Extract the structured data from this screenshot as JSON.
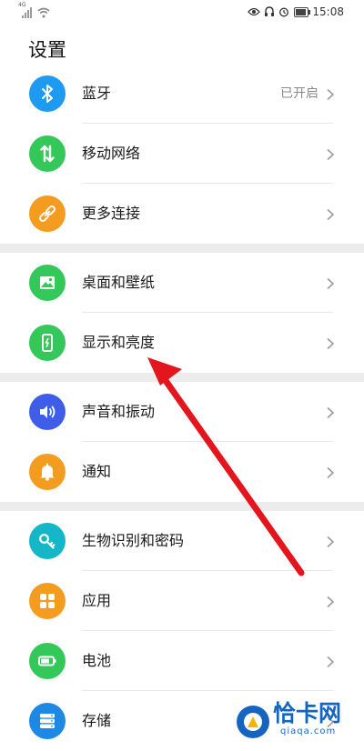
{
  "status_bar": {
    "network_label": "4G",
    "time": "15:08",
    "battery_level": 0.9,
    "icons": [
      "signal-icon",
      "wifi-icon",
      "eye-icon",
      "headset-icon",
      "alarm-icon",
      "battery-icon"
    ]
  },
  "page": {
    "title": "设置"
  },
  "groups": [
    [
      {
        "label": "蓝牙",
        "value": "已开启",
        "icon": "bluetooth-icon",
        "color": "#1e9bf0"
      },
      {
        "label": "移动网络",
        "value": "",
        "icon": "mobile-data-icon",
        "color": "#34c759"
      },
      {
        "label": "更多连接",
        "value": "",
        "icon": "link-icon",
        "color": "#f39c1f"
      }
    ],
    [
      {
        "label": "桌面和壁纸",
        "value": "",
        "icon": "wallpaper-icon",
        "color": "#34c759"
      },
      {
        "label": "显示和亮度",
        "value": "",
        "icon": "display-icon",
        "color": "#34c759"
      }
    ],
    [
      {
        "label": "声音和振动",
        "value": "",
        "icon": "speaker-icon",
        "color": "#3f5ee8"
      },
      {
        "label": "通知",
        "value": "",
        "icon": "bell-icon",
        "color": "#f39c1f"
      }
    ],
    [
      {
        "label": "生物识别和密码",
        "value": "",
        "icon": "key-icon",
        "color": "#16b6c9"
      },
      {
        "label": "应用",
        "value": "",
        "icon": "apps-icon",
        "color": "#f39c1f"
      },
      {
        "label": "电池",
        "value": "",
        "icon": "battery-icon",
        "color": "#34c759"
      },
      {
        "label": "存储",
        "value": "",
        "icon": "storage-icon",
        "color": "#1e88e5"
      }
    ]
  ],
  "annotation": {
    "color": "#e3161e"
  },
  "watermark": {
    "text": "恰卡网",
    "sub": "qiaqa.com",
    "color": "#1565c0"
  }
}
